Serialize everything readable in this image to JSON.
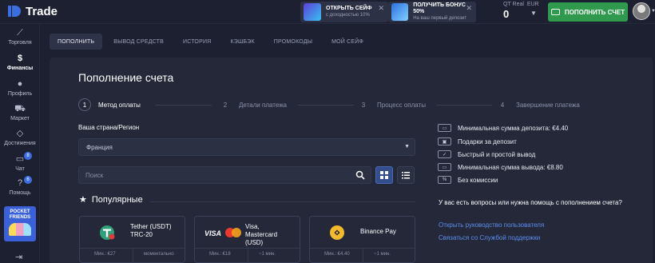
{
  "app": {
    "name": "Trade"
  },
  "promos": [
    {
      "title": "ОТКРЫТЬ СЕЙФ",
      "subtitle": "с доходностью 10%"
    },
    {
      "title": "ПОЛУЧИТЬ БОНУС 50%",
      "subtitle": "На ваш первый депозит"
    }
  ],
  "account": {
    "type": "QT Real",
    "currency": "EUR",
    "balance": "0"
  },
  "header": {
    "deposit_button": "ПОПОЛНИТЬ СЧЕТ"
  },
  "sidebar": {
    "items": [
      {
        "label": "Торговля",
        "icon": "chart-icon"
      },
      {
        "label": "Финансы",
        "icon": "dollar-icon"
      },
      {
        "label": "Профиль",
        "icon": "user-icon"
      },
      {
        "label": "Маркет",
        "icon": "cart-icon"
      },
      {
        "label": "Достижения",
        "icon": "diamond-icon"
      },
      {
        "label": "Чат",
        "icon": "chat-icon",
        "badge": "8"
      },
      {
        "label": "Помощь",
        "icon": "help-icon",
        "badge": "6"
      }
    ],
    "promo": {
      "line1": "POCKET",
      "line2": "FRIENDS"
    }
  },
  "tabs": [
    "ПОПОЛНИТЬ",
    "ВЫВОД СРЕДСТВ",
    "ИСТОРИЯ",
    "КЭШБЭК",
    "ПРОМОКОДЫ",
    "МОЙ СЕЙФ"
  ],
  "page": {
    "title": "Пополнение счета"
  },
  "steps": [
    {
      "num": "1",
      "label": "Метод оплаты"
    },
    {
      "num": "2",
      "label": "Детали платежа"
    },
    {
      "num": "3",
      "label": "Процесс оплаты"
    },
    {
      "num": "4",
      "label": "Завершение платежа"
    }
  ],
  "form": {
    "country_label": "Ваша страна/Регион",
    "country_value": "Франция",
    "search_placeholder": "Поиск"
  },
  "popular": {
    "title": "Популярные",
    "methods": [
      {
        "name_line1": "Tether (USDT)",
        "name_line2": "TRC-20",
        "min": "Мин.: €27",
        "time": "моментально"
      },
      {
        "name_line1": "Visa,",
        "name_line2": "Mastercard",
        "name_line3": "(USD)",
        "min": "Мин.: €18",
        "time": "~1 мин.",
        "visa_text": "VISA"
      },
      {
        "name_line1": "Binance Pay",
        "min": "Мин.: €4.40",
        "time": "~1 мин."
      }
    ]
  },
  "features": [
    "Минимальная сумма депозита: €4.40",
    "Подарки за депозит",
    "Быстрый и простой вывод",
    "Минимальная сумма вывода: €8.80",
    "Без комиссии"
  ],
  "help": {
    "question": "У вас есть вопросы или нужна помощь с пополнением счета?",
    "guide_link": "Открыть руководство пользователя",
    "support_link": "Связаться со Службой поддержки"
  }
}
